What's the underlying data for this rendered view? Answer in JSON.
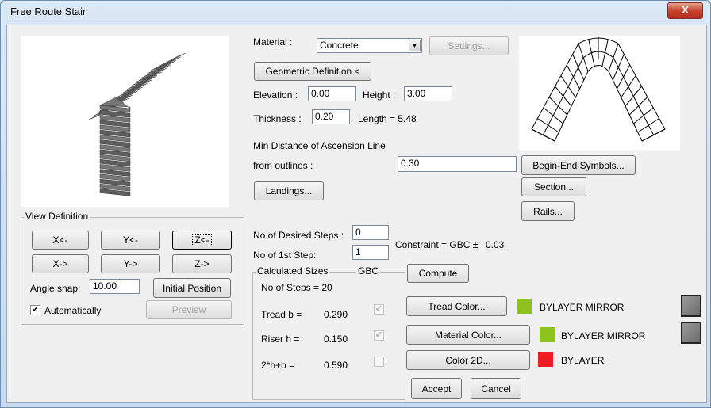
{
  "window": {
    "title": "Free Route Stair",
    "close_label": "X"
  },
  "material": {
    "label": "Material :",
    "value": "Concrete",
    "settings_label": "Settings..."
  },
  "geometric_label": "Geometric Definition <",
  "elevation": {
    "label": "Elevation :",
    "value": "0.00"
  },
  "height": {
    "label": "Height :",
    "value": "3.00"
  },
  "thickness": {
    "label": "Thickness :",
    "value": "0.20"
  },
  "length_text": "Length = 5.48",
  "min_distance": {
    "line1": "Min Distance of Ascension Line",
    "line2": "from outlines :",
    "value": "0.30"
  },
  "landings_label": "Landings...",
  "begin_end_label": "Begin-End Symbols...",
  "section_label": "Section...",
  "rails_label": "Rails...",
  "view_definition": {
    "title": "View Definition",
    "x_minus": "X<-",
    "y_minus": "Y<-",
    "z_minus": "Z<-",
    "x_plus": "X->",
    "y_plus": "Y->",
    "z_plus": "Z->",
    "angle_label": "Angle snap:",
    "angle_value": "10.00",
    "initial_label": "Initial Position",
    "auto_label": "Automatically",
    "auto_checked": true,
    "preview_label": "Preview"
  },
  "steps": {
    "desired_label": "No of Desired Steps :",
    "desired_value": "0",
    "first_label": "No of 1st Step:",
    "first_value": "1",
    "constraint_label": "Constraint = GBC ±",
    "constraint_value": "0.03",
    "compute_label": "Compute"
  },
  "calculated": {
    "title": "Calculated Sizes",
    "gbc_label": "GBC",
    "steps_text": "No of Steps =  20",
    "tread_label": "Tread b =",
    "tread_value": "0.290",
    "tread_checked": true,
    "riser_label": "Riser h =",
    "riser_value": "0.150",
    "riser_checked": true,
    "formula_label": "2*h+b =",
    "formula_value": "0.590",
    "formula_checked": false
  },
  "colors": {
    "tread_button": "Tread Color...",
    "tread_text": "BYLAYER MIRROR",
    "tread_color": "#8dc21f",
    "material_button": "Material Color...",
    "material_text": "BYLAYER MIRROR",
    "material_color": "#8dc21f",
    "color2d_button": "Color 2D...",
    "color2d_text": "BYLAYER",
    "color2d_color": "#ee1c24"
  },
  "accept_label": "Accept",
  "cancel_label": "Cancel"
}
